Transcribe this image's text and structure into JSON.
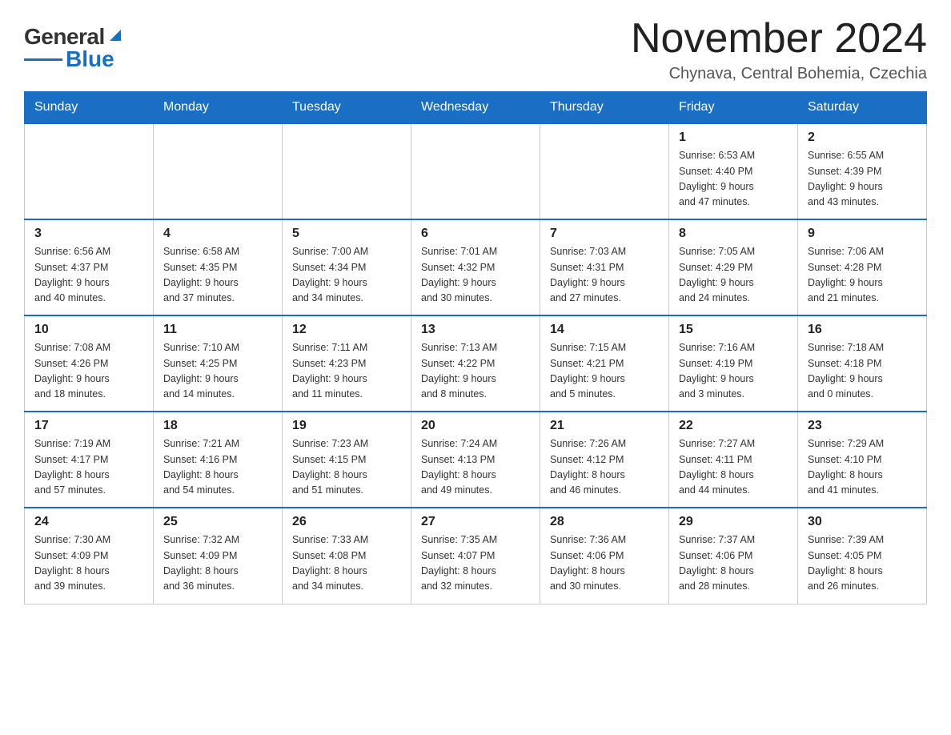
{
  "header": {
    "logo_text_general": "General",
    "logo_text_blue": "Blue",
    "month_title": "November 2024",
    "location": "Chynava, Central Bohemia, Czechia"
  },
  "weekdays": [
    "Sunday",
    "Monday",
    "Tuesday",
    "Wednesday",
    "Thursday",
    "Friday",
    "Saturday"
  ],
  "weeks": [
    [
      {
        "day": "",
        "info": ""
      },
      {
        "day": "",
        "info": ""
      },
      {
        "day": "",
        "info": ""
      },
      {
        "day": "",
        "info": ""
      },
      {
        "day": "",
        "info": ""
      },
      {
        "day": "1",
        "info": "Sunrise: 6:53 AM\nSunset: 4:40 PM\nDaylight: 9 hours\nand 47 minutes."
      },
      {
        "day": "2",
        "info": "Sunrise: 6:55 AM\nSunset: 4:39 PM\nDaylight: 9 hours\nand 43 minutes."
      }
    ],
    [
      {
        "day": "3",
        "info": "Sunrise: 6:56 AM\nSunset: 4:37 PM\nDaylight: 9 hours\nand 40 minutes."
      },
      {
        "day": "4",
        "info": "Sunrise: 6:58 AM\nSunset: 4:35 PM\nDaylight: 9 hours\nand 37 minutes."
      },
      {
        "day": "5",
        "info": "Sunrise: 7:00 AM\nSunset: 4:34 PM\nDaylight: 9 hours\nand 34 minutes."
      },
      {
        "day": "6",
        "info": "Sunrise: 7:01 AM\nSunset: 4:32 PM\nDaylight: 9 hours\nand 30 minutes."
      },
      {
        "day": "7",
        "info": "Sunrise: 7:03 AM\nSunset: 4:31 PM\nDaylight: 9 hours\nand 27 minutes."
      },
      {
        "day": "8",
        "info": "Sunrise: 7:05 AM\nSunset: 4:29 PM\nDaylight: 9 hours\nand 24 minutes."
      },
      {
        "day": "9",
        "info": "Sunrise: 7:06 AM\nSunset: 4:28 PM\nDaylight: 9 hours\nand 21 minutes."
      }
    ],
    [
      {
        "day": "10",
        "info": "Sunrise: 7:08 AM\nSunset: 4:26 PM\nDaylight: 9 hours\nand 18 minutes."
      },
      {
        "day": "11",
        "info": "Sunrise: 7:10 AM\nSunset: 4:25 PM\nDaylight: 9 hours\nand 14 minutes."
      },
      {
        "day": "12",
        "info": "Sunrise: 7:11 AM\nSunset: 4:23 PM\nDaylight: 9 hours\nand 11 minutes."
      },
      {
        "day": "13",
        "info": "Sunrise: 7:13 AM\nSunset: 4:22 PM\nDaylight: 9 hours\nand 8 minutes."
      },
      {
        "day": "14",
        "info": "Sunrise: 7:15 AM\nSunset: 4:21 PM\nDaylight: 9 hours\nand 5 minutes."
      },
      {
        "day": "15",
        "info": "Sunrise: 7:16 AM\nSunset: 4:19 PM\nDaylight: 9 hours\nand 3 minutes."
      },
      {
        "day": "16",
        "info": "Sunrise: 7:18 AM\nSunset: 4:18 PM\nDaylight: 9 hours\nand 0 minutes."
      }
    ],
    [
      {
        "day": "17",
        "info": "Sunrise: 7:19 AM\nSunset: 4:17 PM\nDaylight: 8 hours\nand 57 minutes."
      },
      {
        "day": "18",
        "info": "Sunrise: 7:21 AM\nSunset: 4:16 PM\nDaylight: 8 hours\nand 54 minutes."
      },
      {
        "day": "19",
        "info": "Sunrise: 7:23 AM\nSunset: 4:15 PM\nDaylight: 8 hours\nand 51 minutes."
      },
      {
        "day": "20",
        "info": "Sunrise: 7:24 AM\nSunset: 4:13 PM\nDaylight: 8 hours\nand 49 minutes."
      },
      {
        "day": "21",
        "info": "Sunrise: 7:26 AM\nSunset: 4:12 PM\nDaylight: 8 hours\nand 46 minutes."
      },
      {
        "day": "22",
        "info": "Sunrise: 7:27 AM\nSunset: 4:11 PM\nDaylight: 8 hours\nand 44 minutes."
      },
      {
        "day": "23",
        "info": "Sunrise: 7:29 AM\nSunset: 4:10 PM\nDaylight: 8 hours\nand 41 minutes."
      }
    ],
    [
      {
        "day": "24",
        "info": "Sunrise: 7:30 AM\nSunset: 4:09 PM\nDaylight: 8 hours\nand 39 minutes."
      },
      {
        "day": "25",
        "info": "Sunrise: 7:32 AM\nSunset: 4:09 PM\nDaylight: 8 hours\nand 36 minutes."
      },
      {
        "day": "26",
        "info": "Sunrise: 7:33 AM\nSunset: 4:08 PM\nDaylight: 8 hours\nand 34 minutes."
      },
      {
        "day": "27",
        "info": "Sunrise: 7:35 AM\nSunset: 4:07 PM\nDaylight: 8 hours\nand 32 minutes."
      },
      {
        "day": "28",
        "info": "Sunrise: 7:36 AM\nSunset: 4:06 PM\nDaylight: 8 hours\nand 30 minutes."
      },
      {
        "day": "29",
        "info": "Sunrise: 7:37 AM\nSunset: 4:06 PM\nDaylight: 8 hours\nand 28 minutes."
      },
      {
        "day": "30",
        "info": "Sunrise: 7:39 AM\nSunset: 4:05 PM\nDaylight: 8 hours\nand 26 minutes."
      }
    ]
  ]
}
